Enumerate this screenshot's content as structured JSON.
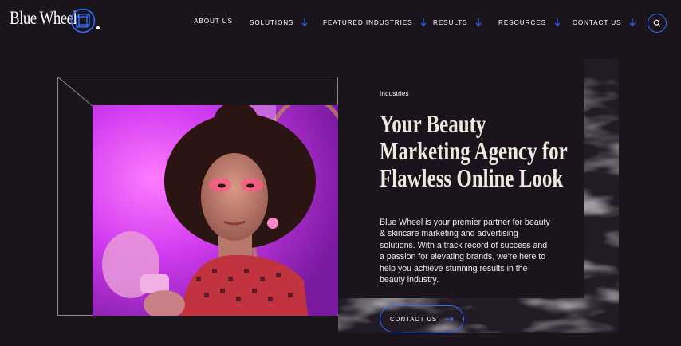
{
  "brand": {
    "name": "Blue Wheel",
    "accent_color": "#2f6bff",
    "background": "#1b141c"
  },
  "nav": {
    "items": [
      {
        "label": "ABOUT US",
        "has_dropdown": false
      },
      {
        "label": "SOLUTIONS",
        "has_dropdown": true
      },
      {
        "label": "FEATURED INDUSTRIES",
        "has_dropdown": true
      },
      {
        "label": "RESULTS",
        "has_dropdown": true
      },
      {
        "label": "RESOURCES",
        "has_dropdown": true
      },
      {
        "label": "CONTACT US",
        "has_dropdown": true
      }
    ],
    "search_icon": "search-icon",
    "dropdown_icon": "arrow-down-icon"
  },
  "hero": {
    "eyebrow": "Industries",
    "headline_lines": [
      "Your Beauty",
      "Marketing Agency for",
      "Flawless Online Look"
    ],
    "body": "Blue Wheel is your premier partner for beauty & skincare marketing and advertising solutions. With a track record of success and a passion for elevating brands, we're here to help you achieve stunning results in the beauty industry.",
    "cta_label": "CONTACT US",
    "cta_icon": "arrow-right-icon"
  }
}
